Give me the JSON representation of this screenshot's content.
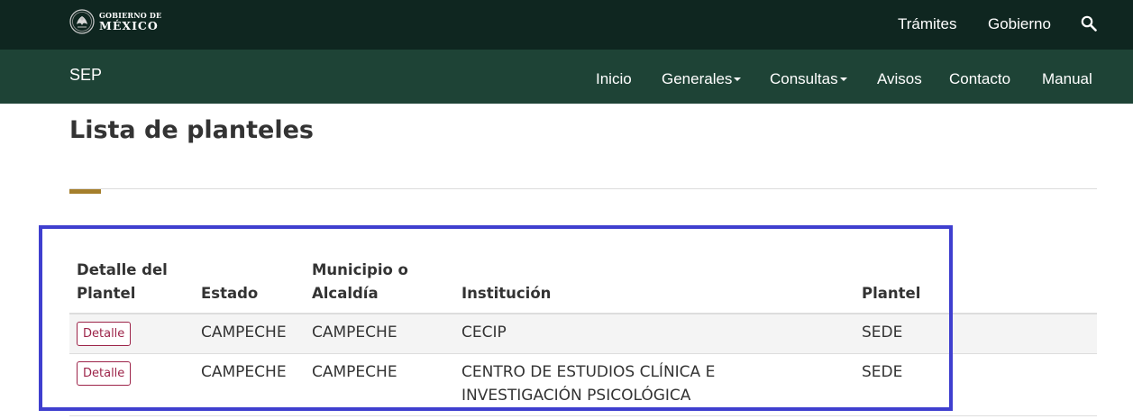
{
  "colors": {
    "topbar_bg": "#0f2620",
    "subbar_bg": "#1e4336",
    "accent_gold": "#a57f2c",
    "button_border": "#9d2449",
    "highlight_box": "#3f3fcf"
  },
  "header": {
    "logo": {
      "line1": "GOBIERNO DE",
      "line2": "MÉXICO"
    },
    "links": [
      "Trámites",
      "Gobierno"
    ],
    "search_icon": "search-icon"
  },
  "subheader": {
    "site_name": "SEP",
    "nav": [
      {
        "label": "Inicio",
        "has_dropdown": false
      },
      {
        "label": "Generales",
        "has_dropdown": true
      },
      {
        "label": "Consultas",
        "has_dropdown": true
      },
      {
        "label": "Avisos",
        "has_dropdown": false
      },
      {
        "label": "Contacto",
        "has_dropdown": false
      },
      {
        "label": "Manual",
        "has_dropdown": false
      }
    ]
  },
  "page": {
    "title": "Lista de planteles"
  },
  "table": {
    "headers": [
      [
        "Detalle del",
        "Plantel"
      ],
      [
        "Estado"
      ],
      [
        "Municipio o",
        "Alcaldía"
      ],
      [
        "Institución"
      ],
      [
        "Plantel"
      ]
    ],
    "rows": [
      {
        "action_label": "Detalle",
        "estado": "CAMPECHE",
        "municipio": "CAMPECHE",
        "institucion": [
          "CECIP"
        ],
        "plantel": "SEDE"
      },
      {
        "action_label": "Detalle",
        "estado": "CAMPECHE",
        "municipio": "CAMPECHE",
        "institucion": [
          "CENTRO DE ESTUDIOS CLÍNICA E",
          "INVESTIGACIÓN PSICOLÓGICA"
        ],
        "plantel": "SEDE"
      }
    ]
  }
}
